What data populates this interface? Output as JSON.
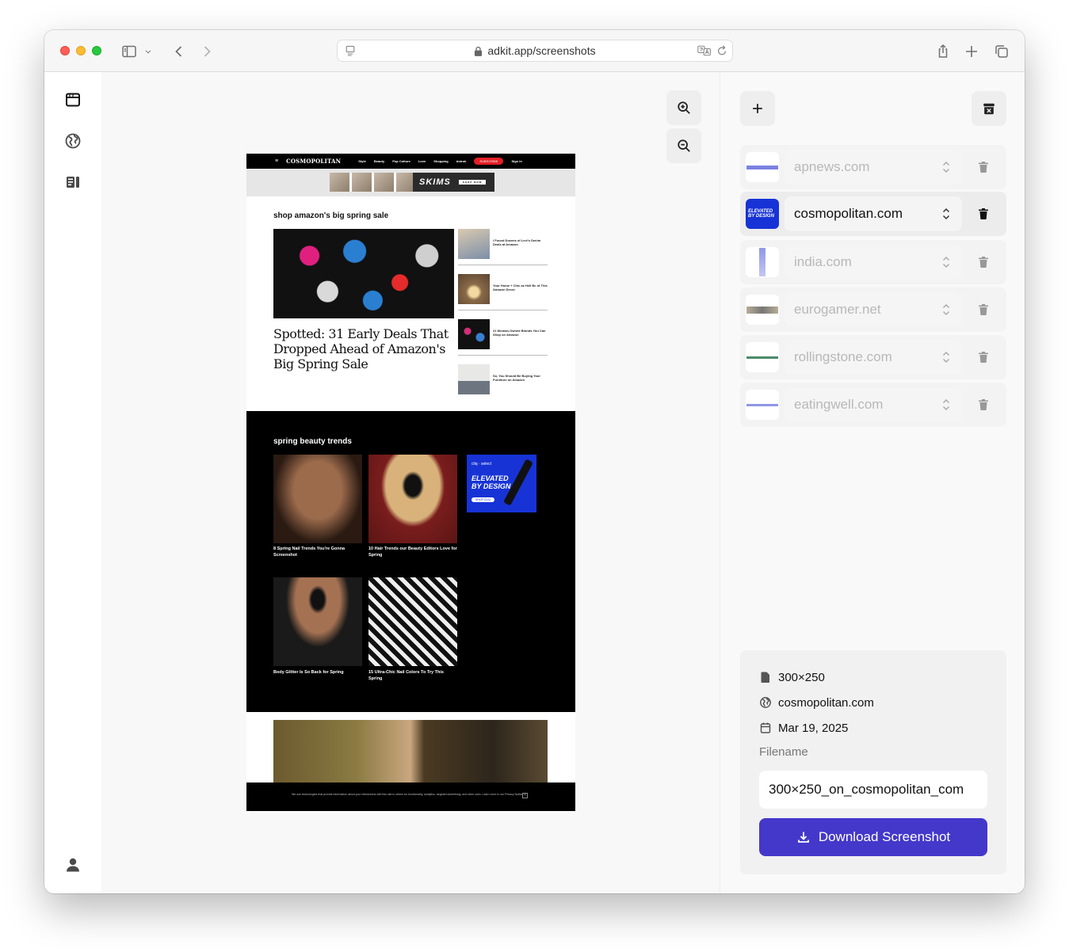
{
  "browser": {
    "url": "adkit.app/screenshots"
  },
  "preview": {
    "cosmo": {
      "logo": "COSMOPOLITAN",
      "nav": [
        "Style",
        "Beauty",
        "Pop Culture",
        "Love",
        "Shopping",
        "Astrok"
      ],
      "subscribe": "SUBSCRIBE",
      "signin": "Sign In",
      "ad_brand": "SKIMS",
      "ad_cta": "SHOP NOW",
      "section1_title": "shop amazon's big spring sale",
      "hero_headline": "Spotted: 31 Early Deals That Dropped Ahead of Amazon's Big Spring Sale",
      "side_items": [
        "I Found Dozens of Levi's Denim Deals at Amazon",
        "Your Home + Chic as Hell Bc of This Amazon Decor",
        "21 Woman-Owned Brands You Can Shop on Amazon",
        "So, You Should Be Buying Your Furniture on Amazon"
      ],
      "section2_title": "spring beauty trends",
      "beauty_items": [
        "8 Spring Nail Trends You're Gonna Screenshot",
        "10 Hair Trends our Beauty Editors Love for Spring",
        "Body Glitter Is So Back for Spring",
        "15 Ultra-Chic Nail Colors To Try This Spring"
      ],
      "cliq_ad": {
        "brand": "cliq · select",
        "headline": "ELEVATED BY DESIGN",
        "cta": "SHOP CLIQ"
      },
      "cookie_text": "We use technologies that provide information about your interactions with this site to others for functionality, analytics, targeted advertising, and other uses. Learn more in our Privacy Notice.",
      "cookie_close": "×"
    }
  },
  "sites": [
    {
      "name": "apnews.com",
      "active": false
    },
    {
      "name": "cosmopolitan.com",
      "active": true
    },
    {
      "name": "india.com",
      "active": false
    },
    {
      "name": "eurogamer.net",
      "active": false
    },
    {
      "name": "rollingstone.com",
      "active": false
    },
    {
      "name": "eatingwell.com",
      "active": false
    }
  ],
  "details": {
    "size": "300×250",
    "site": "cosmopolitan.com",
    "date": "Mar 19, 2025",
    "filename_label": "Filename",
    "filename_value": "300×250_on_cosmopolitan_com",
    "download_label": "Download Screenshot"
  },
  "colors": {
    "accent": "#4338ca",
    "cliq_blue": "#1733d6",
    "cosmo_red": "#e41e26"
  }
}
